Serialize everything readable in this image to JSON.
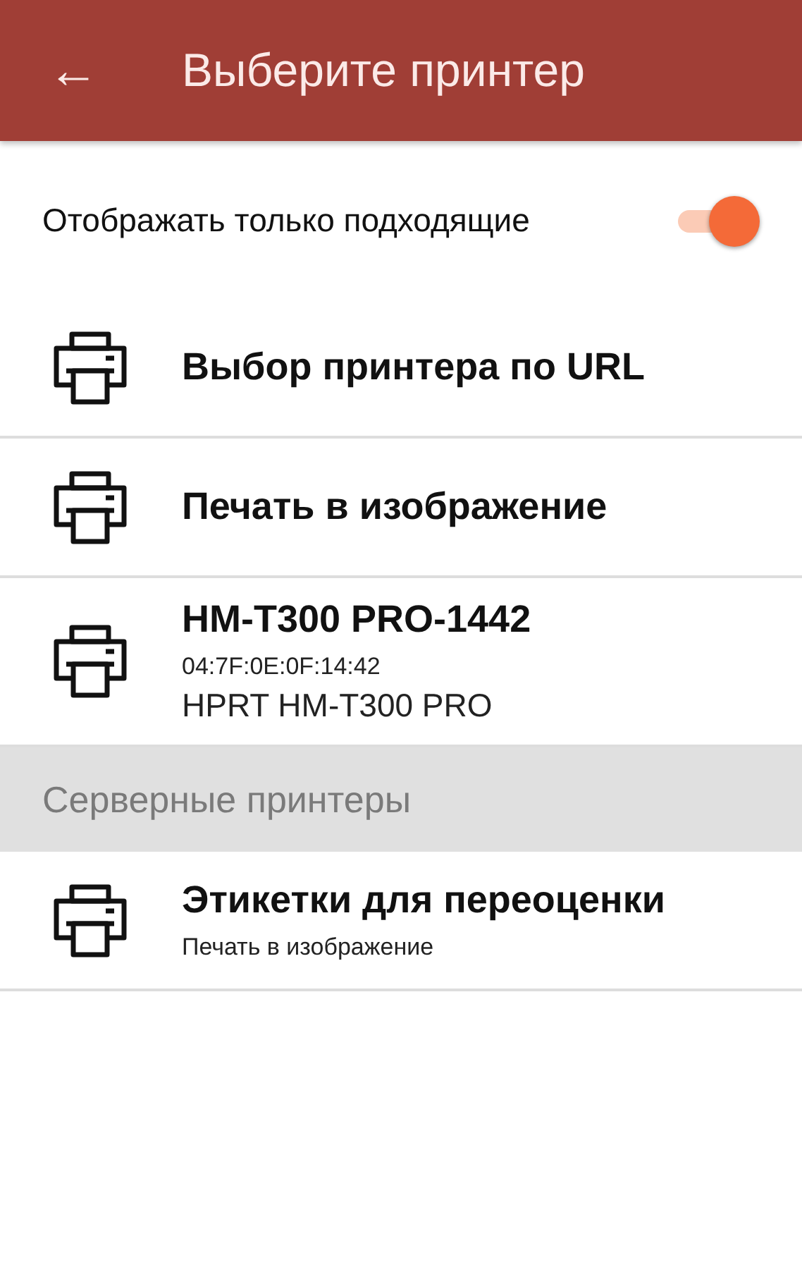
{
  "app_bar": {
    "back_icon": "←",
    "title": "Выберите принтер"
  },
  "filter": {
    "label": "Отображать только подходящие",
    "on": true
  },
  "printers": [
    {
      "title": "Выбор принтера по URL"
    },
    {
      "title": "Печать в изображение"
    },
    {
      "title": "HM-T300 PRO-1442",
      "details": [
        {
          "kind": "small",
          "text": "04:7F:0E:0F:14:42"
        },
        {
          "kind": "normal",
          "text": "HPRT HM-T300 PRO"
        }
      ]
    }
  ],
  "server_section": {
    "header": "Серверные принтеры",
    "printers": [
      {
        "title": "Этикетки для переоценки",
        "details": [
          {
            "kind": "small",
            "text": "Печать в изображение"
          }
        ]
      }
    ]
  }
}
